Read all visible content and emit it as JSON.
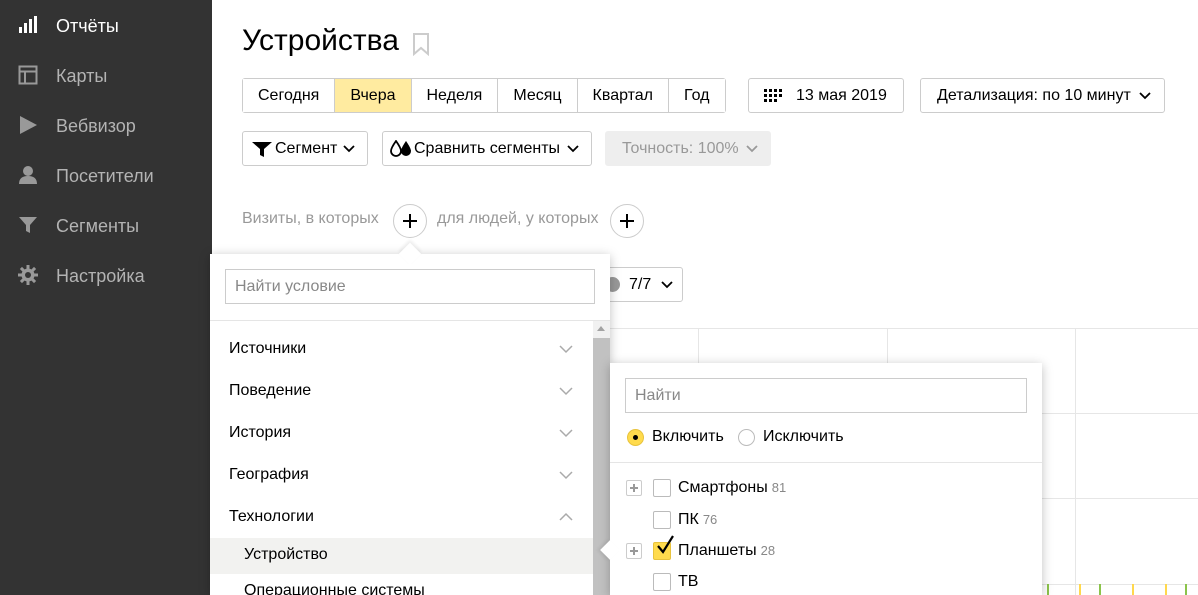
{
  "sidebar": {
    "items": [
      {
        "label": "Отчёты",
        "icon": "bar-chart-icon",
        "active": true
      },
      {
        "label": "Карты",
        "icon": "map-icon",
        "active": false
      },
      {
        "label": "Вебвизор",
        "icon": "play-icon",
        "active": false
      },
      {
        "label": "Посетители",
        "icon": "person-icon",
        "active": false
      },
      {
        "label": "Сегменты",
        "icon": "filter-icon",
        "active": false
      },
      {
        "label": "Настройка",
        "icon": "gear-icon",
        "active": false
      }
    ]
  },
  "header": {
    "title": "Устройства"
  },
  "toolbar": {
    "periods": [
      "Сегодня",
      "Вчера",
      "Неделя",
      "Месяц",
      "Квартал",
      "Год"
    ],
    "active_period": "Вчера",
    "date_label": "13 мая 2019",
    "detail_label": "Детализация: по 10 минут",
    "segment_label": "Сегмент",
    "compare_label": "Сравнить сегменты",
    "accuracy_label": "Точность: 100%"
  },
  "segment_builder": {
    "visits_label": "Визиты, в которых",
    "people_label": "для людей, у которых",
    "counter_label": "7/7"
  },
  "condition_popup": {
    "search_placeholder": "Найти условие",
    "categories": [
      "Источники",
      "Поведение",
      "История",
      "География",
      "Технологии"
    ],
    "subitems": [
      "Устройство",
      "Операционные системы"
    ],
    "active_subitem": "Устройство"
  },
  "device_popup": {
    "search_placeholder": "Найти",
    "include_label": "Включить",
    "exclude_label": "Исключить",
    "devices": [
      {
        "name": "Смартфоны",
        "count": "81",
        "checked": false,
        "expandable": true
      },
      {
        "name": "ПК",
        "count": "76",
        "checked": false,
        "expandable": false
      },
      {
        "name": "Планшеты",
        "count": "28",
        "checked": true,
        "expandable": true
      },
      {
        "name": "ТВ",
        "count": "",
        "checked": false,
        "expandable": false
      }
    ]
  },
  "colors": {
    "sidebar_bg": "#333333",
    "active_period_bg": "#ffeba0",
    "accent_yellow": "#ffdb4d",
    "chart_green": "#8bc34a",
    "chart_yellow": "#ffd84d"
  }
}
